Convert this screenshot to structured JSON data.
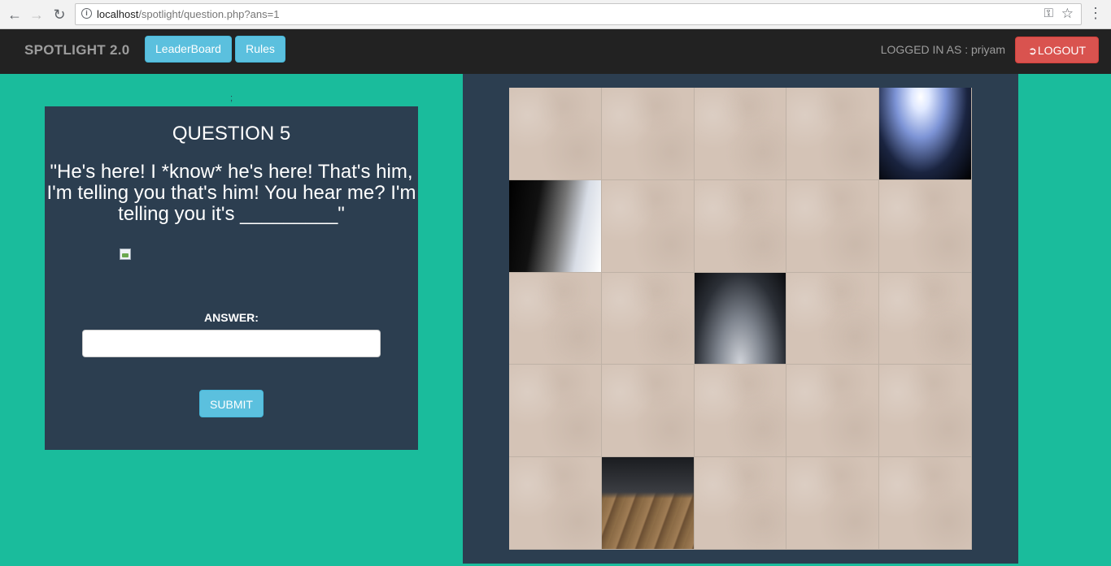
{
  "browser": {
    "url_host": "localhost",
    "url_path": "/spotlight/question.php?ans=1",
    "back_icon": "arrow-left-icon",
    "forward_icon": "arrow-right-icon",
    "reload_icon": "reload-icon",
    "info_icon": "info-icon",
    "key_icon": "key-icon",
    "star_icon": "star-icon",
    "menu_icon": "kebab-menu-icon"
  },
  "navbar": {
    "brand": "SPOTLIGHT 2.0",
    "leaderboard_label": "LeaderBoard",
    "rules_label": "Rules",
    "logged_in_text": "LOGGED IN AS : priyam",
    "logout_label": "LOGOUT",
    "logout_icon": "log-in-icon"
  },
  "colors": {
    "page_bg": "#1abc9c",
    "panel_bg": "#2c3e50",
    "navbar_bg": "#222222",
    "info_button": "#5bc0de",
    "danger_button": "#d9534f"
  },
  "question": {
    "separator": ";",
    "title": "QUESTION 5",
    "text": "\"He's here! I *know* he's here! That's him, I'm telling you that's him! You hear me? I'm telling you it's _________\"",
    "image_icon": "broken-image-icon",
    "answer_label": "ANSWER:",
    "answer_value": "",
    "answer_placeholder": "",
    "submit_label": "SUBMIT"
  },
  "puzzle": {
    "rows": 5,
    "cols": 5,
    "tiles": [
      "blank",
      "blank",
      "blank",
      "blank",
      "spotlight-top-right",
      "spotlight-left",
      "blank",
      "blank",
      "blank",
      "blank",
      "blank",
      "blank",
      "spotlight-center",
      "blank",
      "blank",
      "blank",
      "blank",
      "blank",
      "blank",
      "blank",
      "blank",
      "stage-floor",
      "blank",
      "blank",
      "blank"
    ]
  }
}
